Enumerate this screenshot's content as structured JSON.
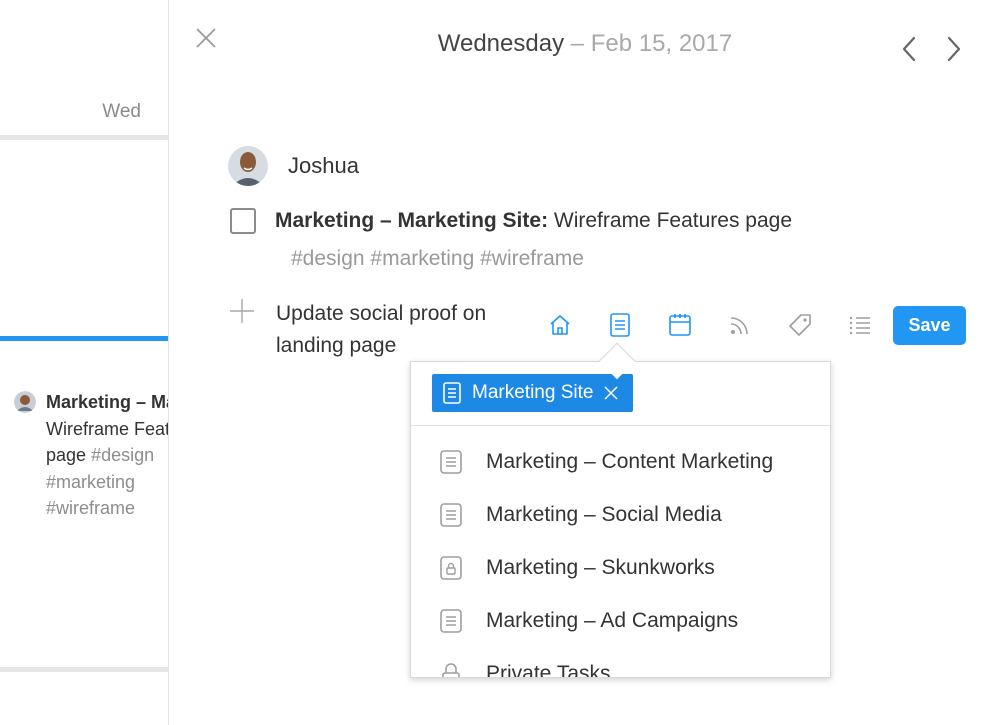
{
  "calendar": {
    "day_label": "Wed",
    "task": {
      "bold": "Marketing – Marketing Site",
      "line3": "Wireframe Features",
      "line4_text": "page",
      "line4_tag": "#design",
      "tag2": "#marketing",
      "tag3": "#wireframe"
    }
  },
  "header": {
    "weekday": "Wednesday",
    "separator": " – ",
    "date": "Feb 15, 2017"
  },
  "assignee": {
    "name": "Joshua"
  },
  "task": {
    "project_bold": "Marketing – Marketing Site:",
    "title": " Wireframe Features page",
    "tags": "#design #marketing #wireframe"
  },
  "new_task": {
    "value": "Update social proof on landing page"
  },
  "toolbar": {
    "icons": [
      "home-icon",
      "project-icon",
      "calendar-icon",
      "rss-icon",
      "tag-icon",
      "list-icon"
    ],
    "save_label": "Save"
  },
  "dropdown": {
    "selected_chip": "Marketing Site",
    "items": [
      {
        "label": "Marketing – Content Marketing",
        "icon": "project-icon"
      },
      {
        "label": "Marketing – Social Media",
        "icon": "project-icon"
      },
      {
        "label": "Marketing – Skunkworks",
        "icon": "lock-project-icon"
      },
      {
        "label": "Marketing – Ad Campaigns",
        "icon": "project-icon"
      },
      {
        "label": "Private Tasks",
        "icon": "lock-icon"
      }
    ]
  },
  "colors": {
    "accent": "#2196f3",
    "chip": "#1e88e5",
    "tag_gray": "#999999"
  }
}
